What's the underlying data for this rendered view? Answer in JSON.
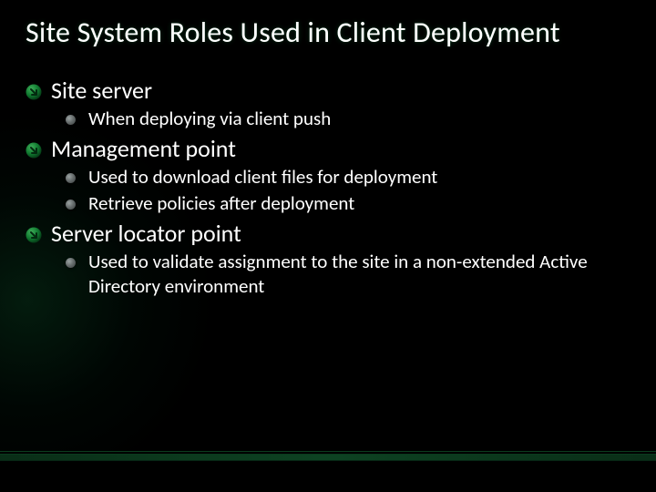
{
  "title": "Site System Roles Used in Client Deployment",
  "items": [
    {
      "label": "Site server",
      "children": [
        {
          "label": "When deploying via client push"
        }
      ]
    },
    {
      "label": "Management point",
      "children": [
        {
          "label": "Used to download client files for deployment"
        },
        {
          "label": "Retrieve policies after deployment"
        }
      ]
    },
    {
      "label": "Server locator point",
      "children": [
        {
          "label": "Used to validate assignment to the site in a non-extended Active Directory environment"
        }
      ]
    }
  ]
}
